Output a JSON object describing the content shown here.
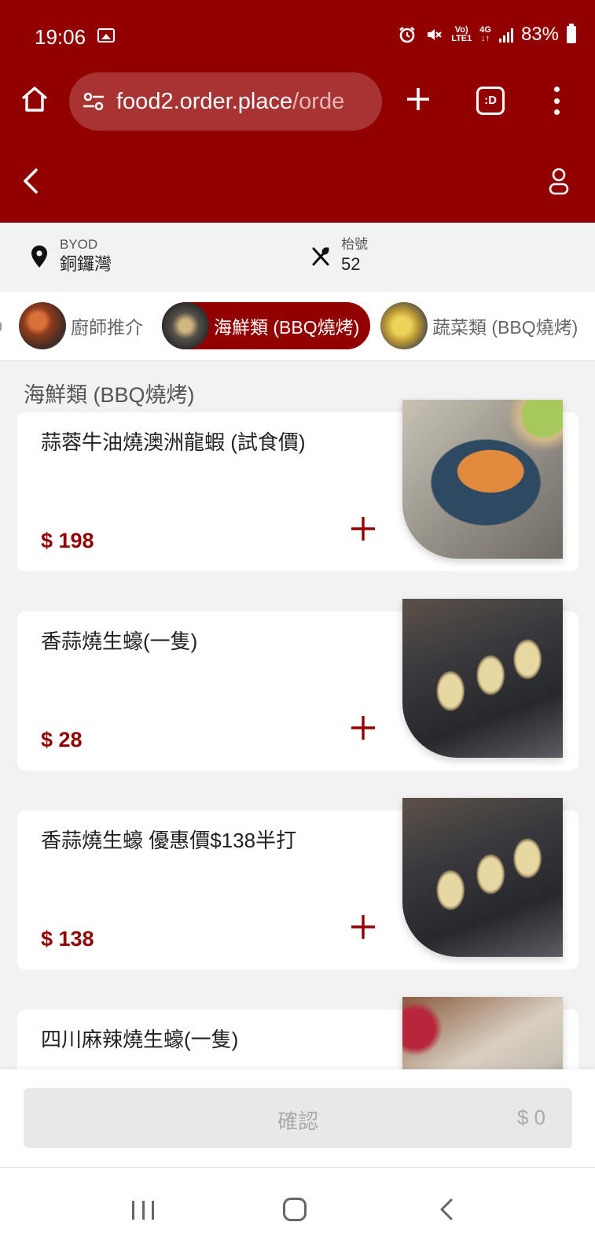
{
  "status": {
    "time": "19:06",
    "signal_top": "Vo)",
    "signal_bottom": "LTE1",
    "net_top": "4G",
    "net_bottom": "↓↑",
    "battery": "83%"
  },
  "browser": {
    "url_main": "food2.order.place",
    "url_rest": "/orde",
    "tabs_label": ":D"
  },
  "icons": {
    "status": [
      "image-icon",
      "alarm-icon",
      "mute-icon",
      "signal-icon",
      "battery-icon"
    ],
    "browser": [
      "home-icon",
      "site-settings-icon",
      "new-tab-icon",
      "tabs-icon",
      "more-icon"
    ],
    "app": [
      "back-icon",
      "user-icon",
      "location-pin-icon",
      "utensils-icon",
      "add-icon"
    ],
    "system_nav": [
      "recent-apps-icon",
      "home-nav-icon",
      "back-nav-icon"
    ]
  },
  "colors": {
    "brand": "#930000",
    "price": "#930000"
  },
  "info": {
    "store_label": "BYOD",
    "store_name": "銅鑼灣",
    "table_label": "枱號",
    "table_number": "52"
  },
  "categories": [
    {
      "label": "廚師推介",
      "active": false
    },
    {
      "label": "海鮮類 (BBQ燒烤)",
      "active": true
    },
    {
      "label": "蔬菜類 (BBQ燒烤)",
      "active": false
    }
  ],
  "section_title": "海鮮類 (BBQ燒烤)",
  "items": [
    {
      "name": "蒜蓉牛油燒澳洲龍蝦 (試食價)",
      "price": "$ 198"
    },
    {
      "name": "香蒜燒生蠔(一隻)",
      "price": "$ 28"
    },
    {
      "name": "香蒜燒生蠔 優惠價$138半打",
      "price": "$ 138"
    },
    {
      "name": "四川麻辣燒生蠔(一隻)",
      "price": ""
    }
  ],
  "confirm": {
    "label": "確認",
    "total": "$ 0"
  }
}
